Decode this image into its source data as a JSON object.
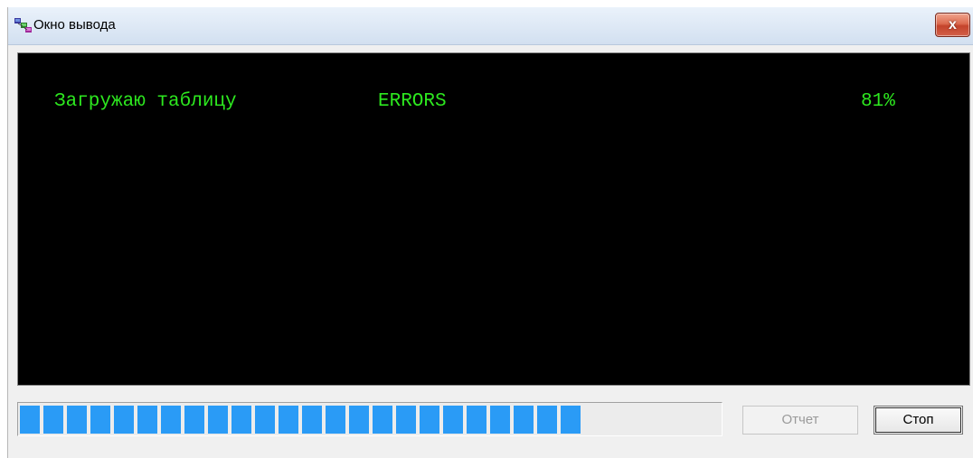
{
  "window": {
    "title": "Окно вывода",
    "close_label": "x",
    "icon": "app-window-icon"
  },
  "console": {
    "background_color": "#000000",
    "text_color": "#2de81f",
    "line": {
      "label": "Загружаю таблицу",
      "table_name": "ERRORS",
      "percent": "81%"
    }
  },
  "progress": {
    "value": 0.81,
    "fill_color": "#2a9bf6"
  },
  "buttons": {
    "report_label": "Отчет",
    "report_enabled": false,
    "stop_label": "Стоп"
  }
}
